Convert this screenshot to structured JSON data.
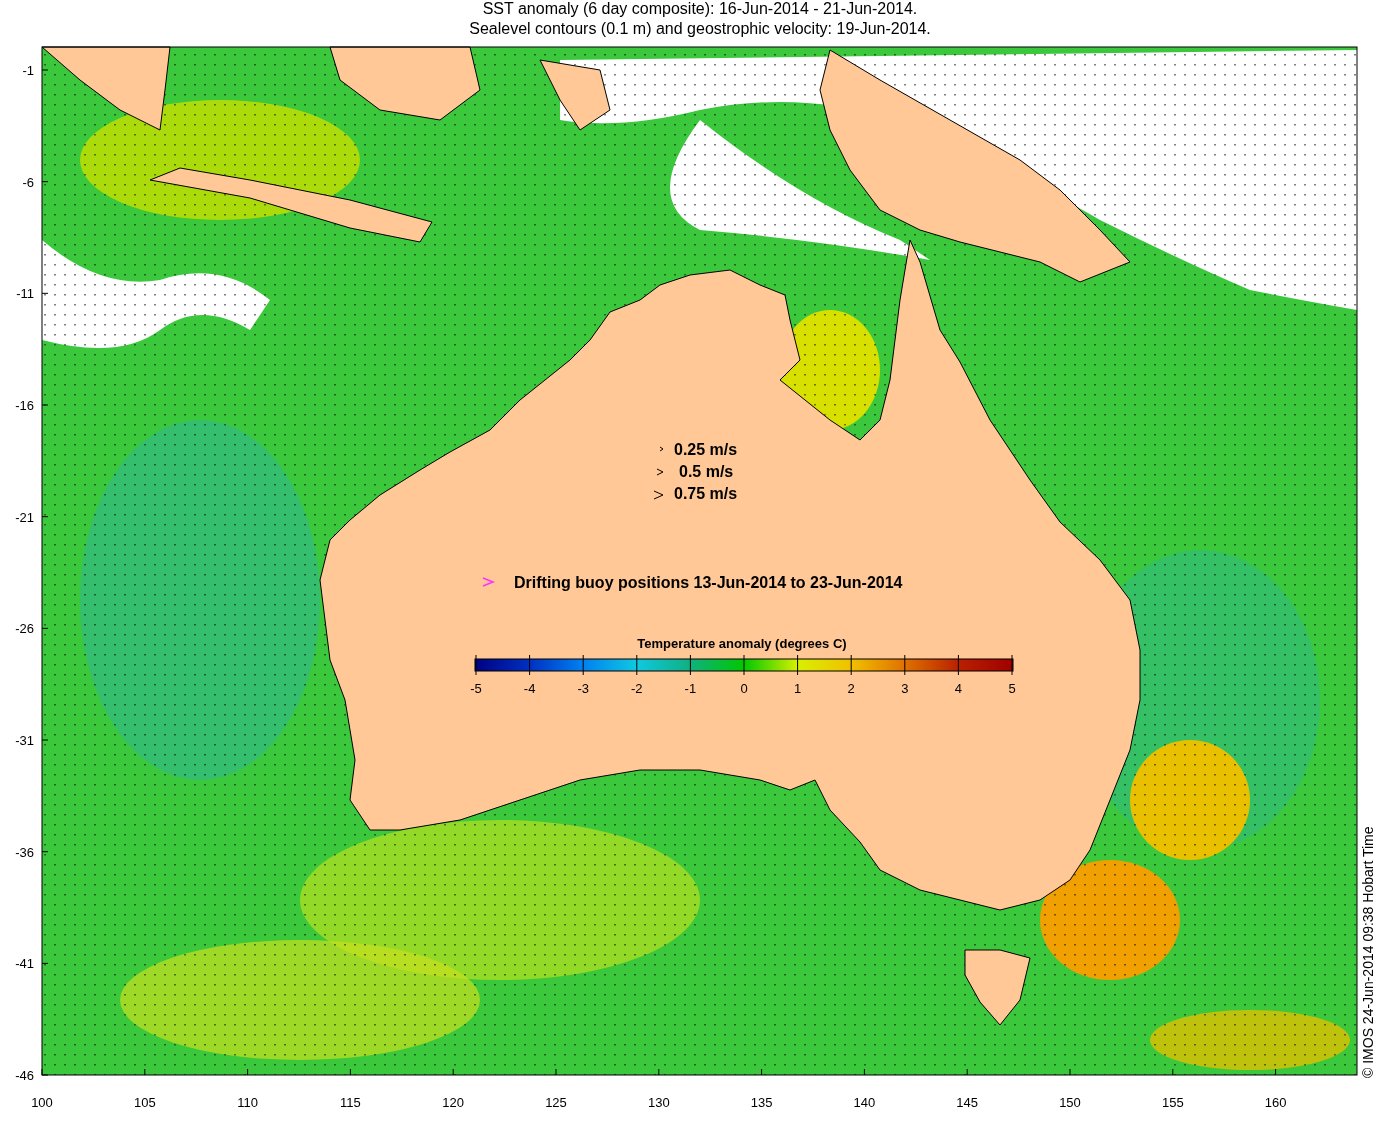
{
  "title_lines": [
    "SST anomaly (6 day composite): 16-Jun-2014 - 21-Jun-2014.",
    "Sealevel contours (0.1 m) and geostrophic velocity: 19-Jun-2014."
  ],
  "y_axis": {
    "ticks": [
      "-1",
      "-6",
      "-11",
      "-16",
      "-21",
      "-26",
      "-31",
      "-36",
      "-41",
      "-46"
    ]
  },
  "x_axis": {
    "ticks": [
      "100",
      "105",
      "110",
      "115",
      "120",
      "125",
      "130",
      "135",
      "140",
      "145",
      "150",
      "155",
      "160"
    ]
  },
  "velocity_legend": [
    {
      "label": "0.25 m/s"
    },
    {
      "label": "0.5 m/s"
    },
    {
      "label": "0.75 m/s"
    }
  ],
  "buoy_legend": {
    "label": "Drifting buoy positions 13-Jun-2014 to 23-Jun-2014"
  },
  "colorbar": {
    "title": "Temperature anomaly (degrees C)",
    "ticks": [
      "-5",
      "-4",
      "-3",
      "-2",
      "-1",
      "0",
      "1",
      "2",
      "3",
      "4",
      "5"
    ]
  },
  "credit": "© IMOS 24-Jun-2014 09:38 Hobart Time"
}
